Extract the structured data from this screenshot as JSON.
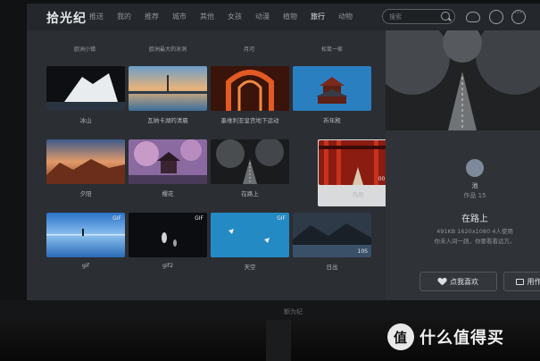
{
  "app": {
    "logo": "拾光纪"
  },
  "nav": {
    "items": [
      {
        "label": "推送"
      },
      {
        "label": "我的"
      },
      {
        "label": "推荐"
      },
      {
        "label": "城市"
      },
      {
        "label": "其他"
      },
      {
        "label": "女孩"
      },
      {
        "label": "动漫"
      },
      {
        "label": "植物"
      },
      {
        "label": "旅行",
        "active": true
      },
      {
        "label": "动物"
      }
    ]
  },
  "search": {
    "placeholder": "搜索"
  },
  "top_icons": [
    "cloud-icon",
    "gear-icon",
    "more-icon"
  ],
  "grid": {
    "top_row_labels": [
      "欧洲小镇",
      "欧洲最大的冰洞",
      "月河",
      "松鼠一家"
    ],
    "tiles": [
      {
        "label": "冰山",
        "badge": "",
        "duration": ""
      },
      {
        "label": "瓦纳卡湖的清晨",
        "badge": "",
        "duration": ""
      },
      {
        "label": "墨维利亚皇宫地下运动",
        "badge": "",
        "duration": ""
      },
      {
        "label": "祈年殿",
        "badge": "",
        "duration": ""
      },
      {
        "label": "夕阳",
        "badge": "",
        "duration": ""
      },
      {
        "label": "樱花",
        "badge": "",
        "duration": ""
      },
      {
        "label": "在路上",
        "badge": "",
        "duration": ""
      },
      {
        "label": "鸟居",
        "badge": "",
        "duration": "00:27"
      },
      {
        "label": "gif",
        "badge": "GIF",
        "duration": ""
      },
      {
        "label": "gif2",
        "badge": "GIF",
        "duration": ""
      },
      {
        "label": "天空",
        "badge": "GIF",
        "duration": ""
      },
      {
        "label": "日出",
        "badge": "",
        "duration": "10S"
      }
    ]
  },
  "panel": {
    "author": "池",
    "works": "作品 15",
    "title": "在路上",
    "meta": "491KB  1620x1080  4人使用",
    "desc": "你未人间一趟，你要看看远方。",
    "like_label": "点我喜欢",
    "set_label": "用作壁纸"
  },
  "monitor": {
    "brand": "额为纪"
  },
  "watermark": {
    "text": "什么值得买"
  }
}
